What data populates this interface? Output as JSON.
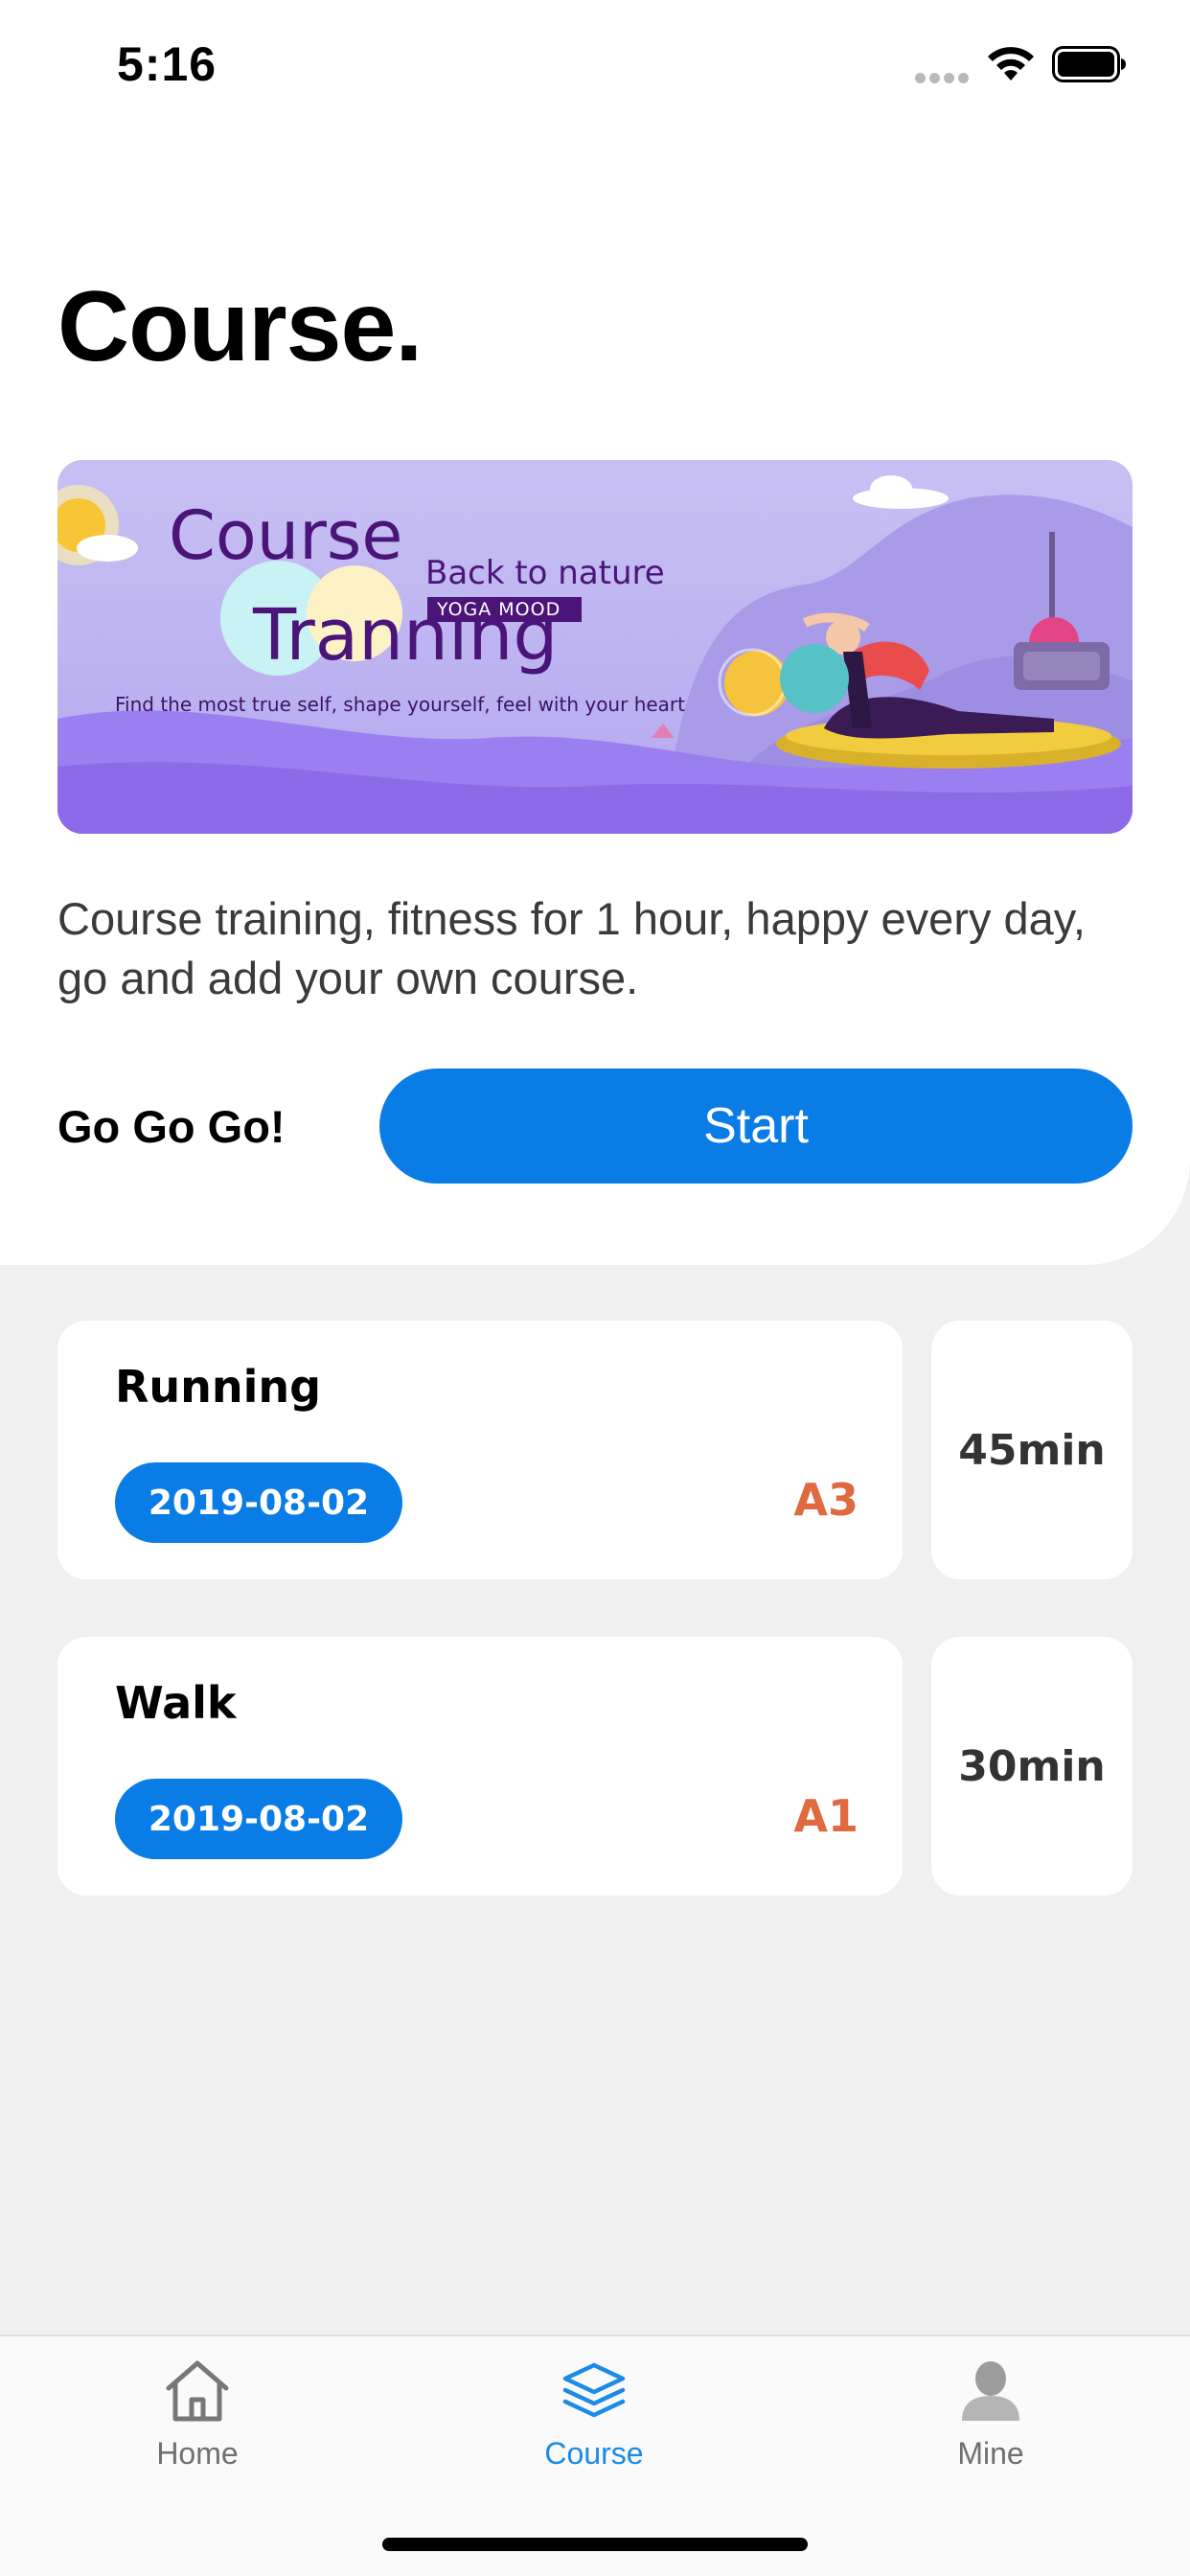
{
  "status_bar": {
    "time": "5:16"
  },
  "page": {
    "title": "Course."
  },
  "banner": {
    "course_word": "Course",
    "tranning_word": "Tranning",
    "back_to_nature": "Back to nature",
    "yoga_mood": "YOGA MOOD",
    "tagline": "Find the most true self, shape yourself, feel with your heart"
  },
  "description": "Course training, fitness for 1 hour, happy every day, go and add your own course.",
  "cta": {
    "label": "Go Go Go!",
    "button_label": "Start"
  },
  "courses": [
    {
      "name": "Running",
      "date": "2019-08-02",
      "level": "A3",
      "duration": "45min"
    },
    {
      "name": "Walk",
      "date": "2019-08-02",
      "level": "A1",
      "duration": "30min"
    }
  ],
  "tabs": [
    {
      "label": "Home",
      "icon": "home-icon",
      "active": false
    },
    {
      "label": "Course",
      "icon": "layers-icon",
      "active": true
    },
    {
      "label": "Mine",
      "icon": "person-icon",
      "active": false
    }
  ],
  "colors": {
    "accent": "#0a7ce6",
    "level": "#e0693f",
    "active_tab": "#1a8be8",
    "banner_text": "#4a1479",
    "background": "#f0f0f0"
  }
}
